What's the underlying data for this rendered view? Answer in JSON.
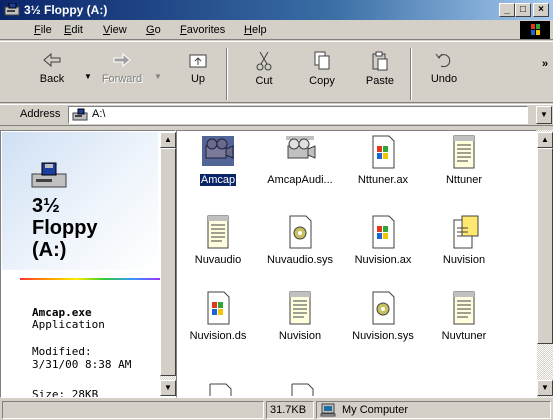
{
  "window": {
    "title": "3½ Floppy (A:)"
  },
  "menubar": {
    "items": [
      "File",
      "Edit",
      "View",
      "Go",
      "Favorites",
      "Help"
    ]
  },
  "toolbar": {
    "back": "Back",
    "forward": "Forward",
    "up": "Up",
    "cut": "Cut",
    "copy": "Copy",
    "paste": "Paste",
    "undo": "Undo",
    "more": "»"
  },
  "address": {
    "label": "Address",
    "value": "A:\\"
  },
  "leftpane": {
    "title": "3½ Floppy (A:)",
    "title_line1": "3½",
    "title_line2": "Floppy",
    "title_line3": "(A:)",
    "selected_name": "Amcap.exe",
    "selected_type": "Application",
    "modified_label": "Modified:",
    "modified_value": "3/31/00 8:38 AM",
    "size_partial": "Size: 28KB"
  },
  "files": [
    {
      "name": "Amcap",
      "icon": "app-camera-icon",
      "selected": true
    },
    {
      "name": "AmcapAudi...",
      "icon": "app-camera-icon",
      "selected": false
    },
    {
      "name": "Nttuner.ax",
      "icon": "system-file-icon",
      "selected": false
    },
    {
      "name": "Nttuner",
      "icon": "text-document-icon",
      "selected": false
    },
    {
      "name": "Nuvaudio",
      "icon": "text-document-icon",
      "selected": false
    },
    {
      "name": "Nuvaudio.sys",
      "icon": "system-gear-icon",
      "selected": false
    },
    {
      "name": "Nuvision.ax",
      "icon": "system-file-icon",
      "selected": false
    },
    {
      "name": "Nuvision",
      "icon": "setup-info-icon",
      "selected": false
    },
    {
      "name": "Nuvision.ds",
      "icon": "system-file-icon",
      "selected": false
    },
    {
      "name": "Nuvision",
      "icon": "text-document-icon",
      "selected": false
    },
    {
      "name": "Nuvision.sys",
      "icon": "system-gear-icon",
      "selected": false
    },
    {
      "name": "Nuvtuner",
      "icon": "text-document-icon",
      "selected": false
    }
  ],
  "status": {
    "size": "31.7KB",
    "zone": "My Computer"
  },
  "colors": {
    "titlebar_start": "#0a246a",
    "titlebar_end": "#a6caf0",
    "face": "#d4d0c8",
    "selection": "#0a246a"
  }
}
